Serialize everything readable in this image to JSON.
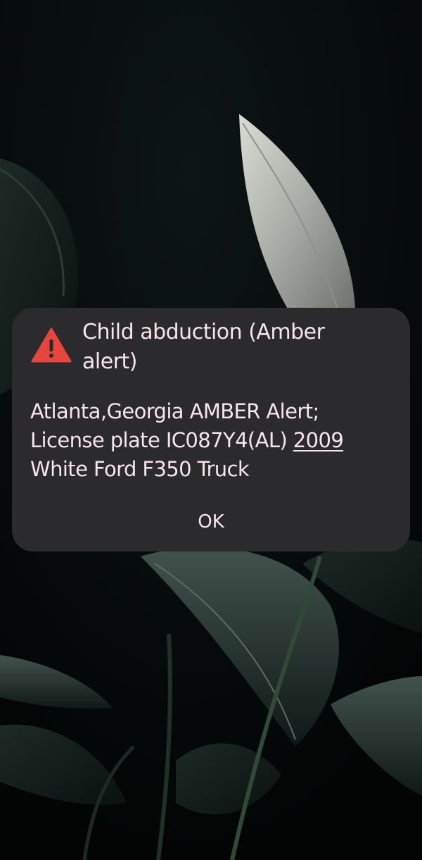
{
  "alert_dialog": {
    "icon": "warning-triangle-icon",
    "icon_color": "#e5463d",
    "title": "Child abduction (Amber alert)",
    "message_line_1": "Atlanta,Georgia AMBER Alert;",
    "message_line_2_prefix": "License plate IC087Y4(AL) ",
    "message_year_link": "2009",
    "message_line_3": "White Ford F350 Truck",
    "ok_label": "OK",
    "background_color": "#2b2a2c",
    "text_color": "#f6e5ea"
  },
  "wallpaper": {
    "description_icon": "plant-leaves-wallpaper"
  }
}
